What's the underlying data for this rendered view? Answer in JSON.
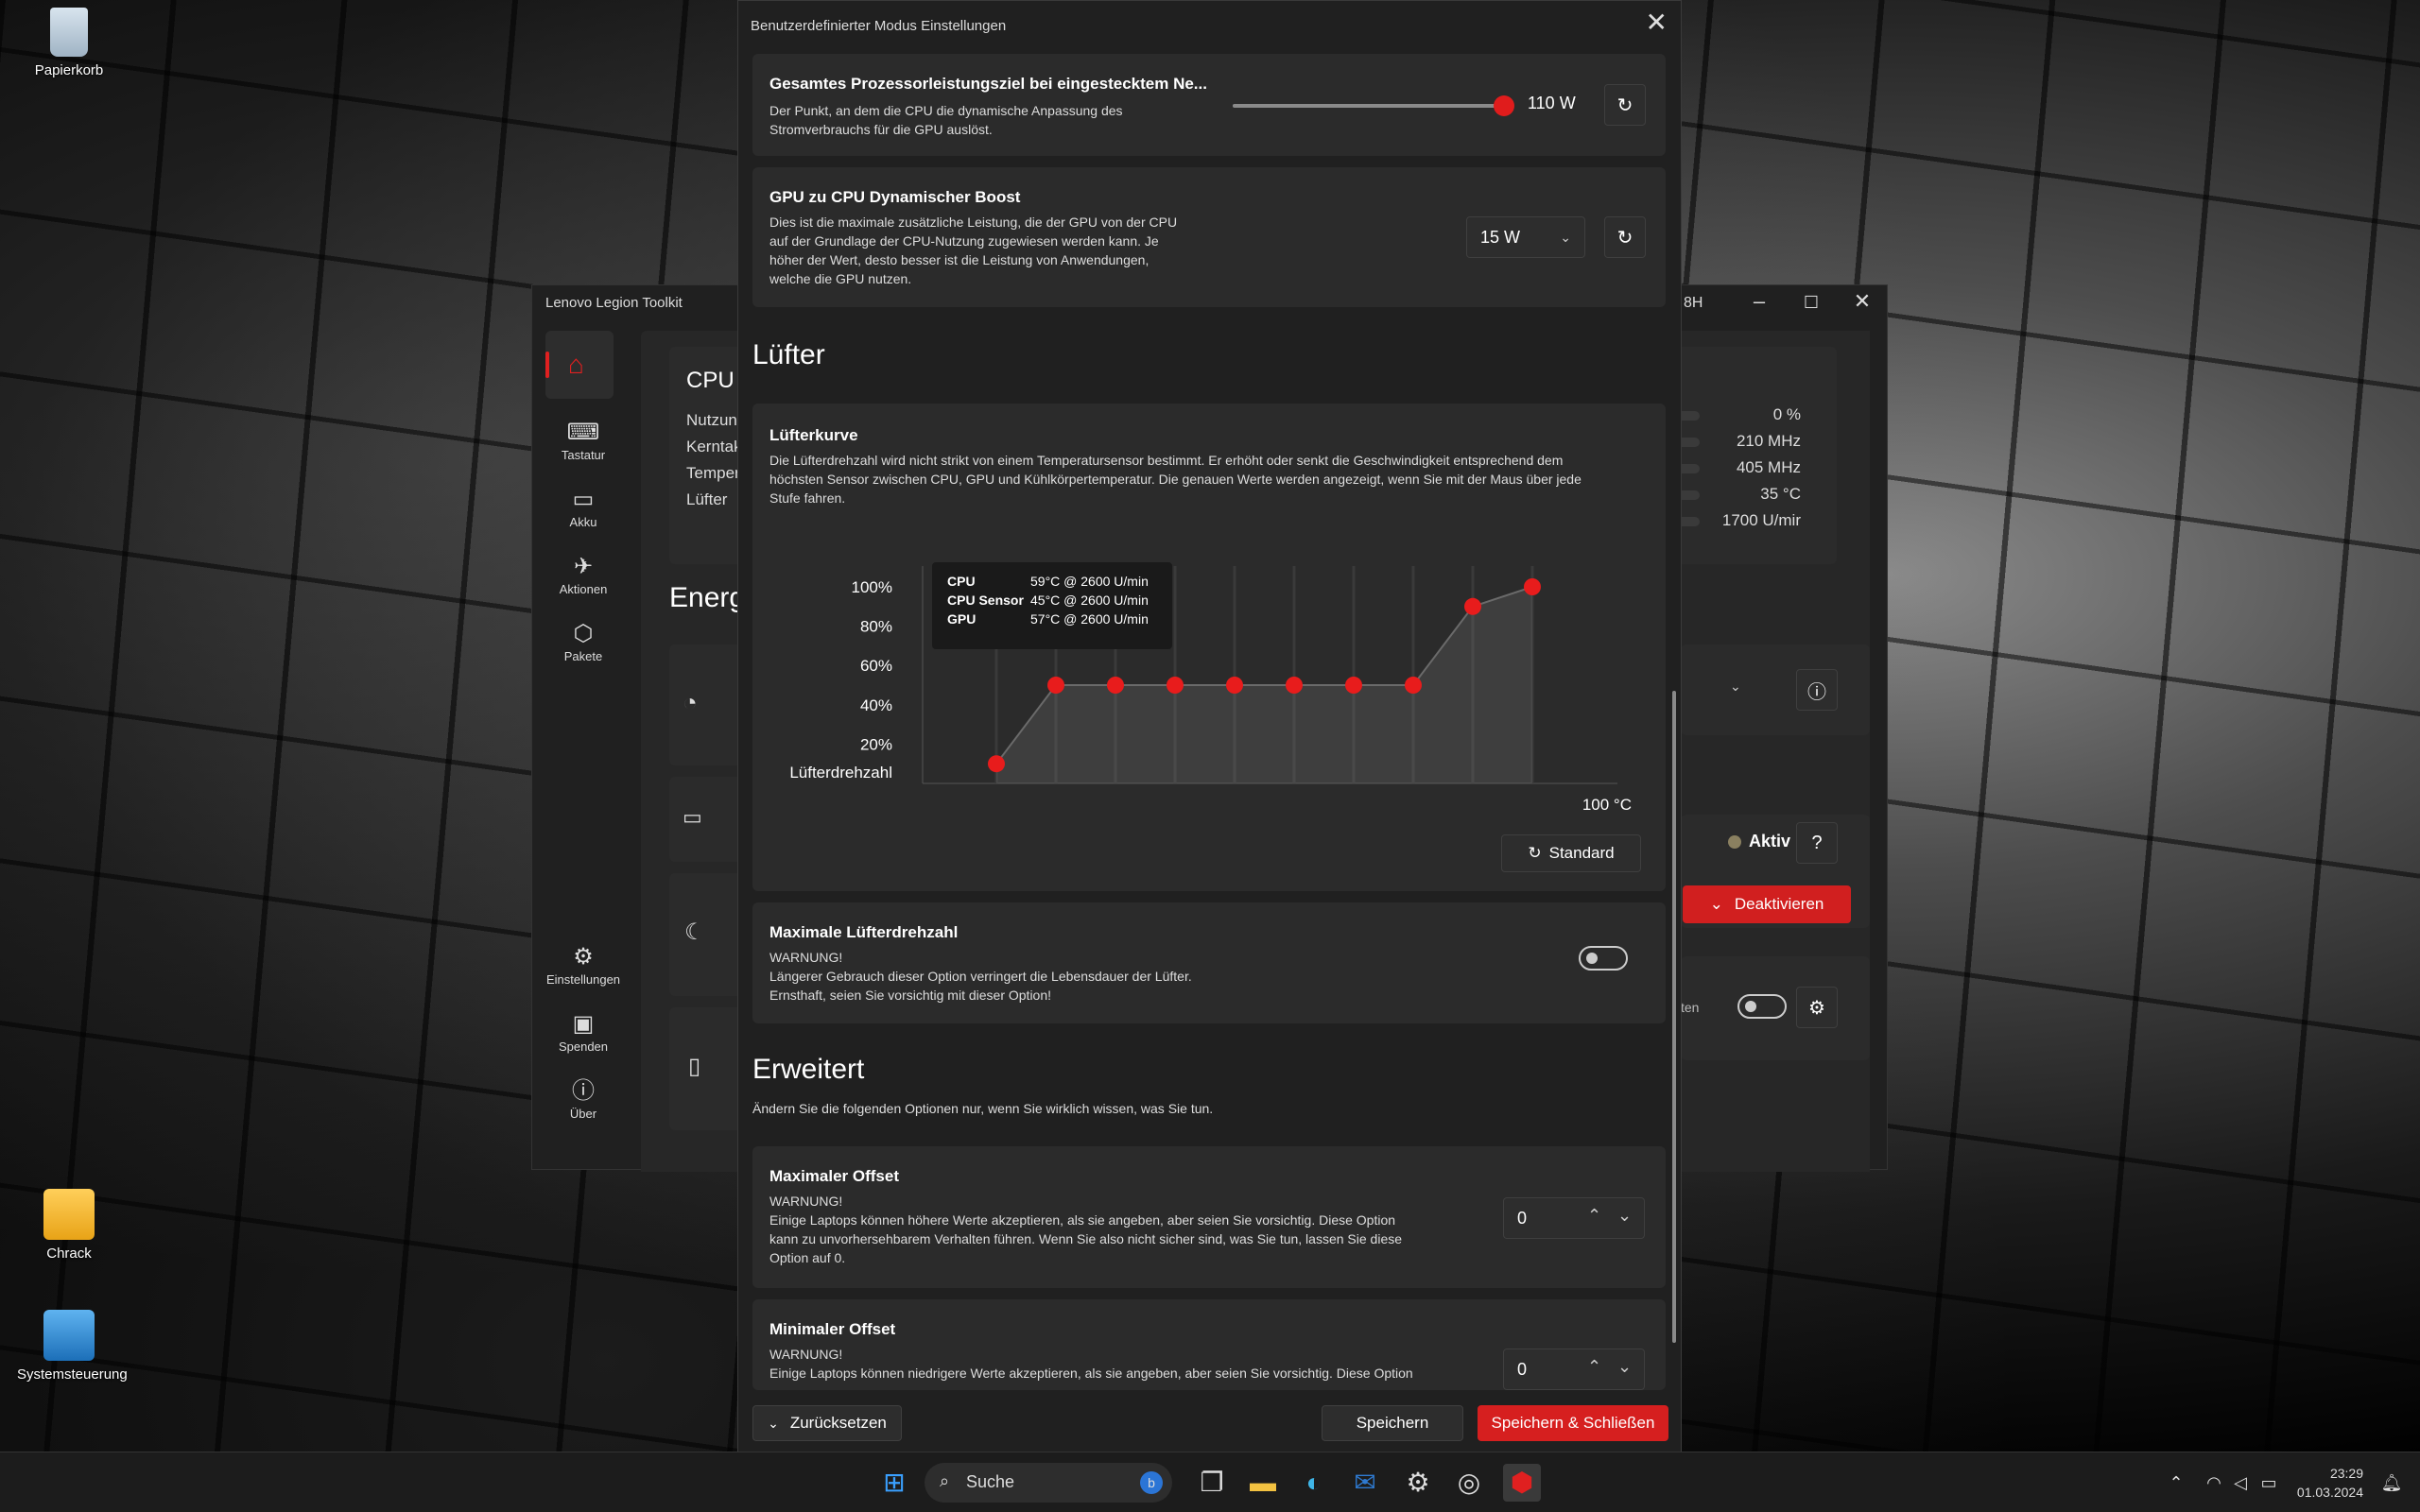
{
  "desktop": {
    "icons": [
      {
        "name": "recycle-bin",
        "label": "Papierkorb"
      },
      {
        "name": "user-folder",
        "label": "Chrack"
      },
      {
        "name": "control-panel",
        "label": "Systemsteuerung"
      }
    ]
  },
  "bgwindow": {
    "title": "Lenovo Legion Toolkit",
    "title_suffix": "8H",
    "nav": [
      {
        "label": "Tastatur",
        "icon": "keyboard-icon"
      },
      {
        "label": "Akku",
        "icon": "battery-icon"
      },
      {
        "label": "Aktionen",
        "icon": "actions-icon"
      },
      {
        "label": "Pakete",
        "icon": "package-icon"
      },
      {
        "label": "Einstellungen",
        "icon": "gear-icon"
      },
      {
        "label": "Spenden",
        "icon": "donate-icon"
      },
      {
        "label": "Über",
        "icon": "info-icon"
      }
    ],
    "cpu_panel": {
      "title": "CPU",
      "rows": [
        "Nutzun",
        "Kerntak",
        "Temper",
        "Lüfter"
      ],
      "values": [
        "0 %",
        "210 MHz",
        "405 MHz",
        "35 °C",
        "1700 U/mir"
      ]
    },
    "energy_heading": "Energ",
    "aktiv_label": "Aktiv",
    "deactivate_label": "Deaktivieren",
    "ten_fragment": "ten"
  },
  "dialog": {
    "title": "Benutzerdefinierter Modus Einstellungen",
    "power_target": {
      "title": "Gesamtes Prozessorleistungsziel bei eingestecktem Ne...",
      "desc1": "Der Punkt, an dem die CPU die dynamische Anpassung des",
      "desc2": "Stromverbrauchs für die GPU auslöst.",
      "value": "110 W",
      "slider_fraction": 0.99
    },
    "gpu_boost": {
      "title": "GPU zu CPU Dynamischer Boost",
      "desc1": "Dies ist die maximale zusätzliche Leistung, die der GPU von der CPU",
      "desc2": "auf der Grundlage der CPU-Nutzung zugewiesen werden kann. Je",
      "desc3": "höher der Wert, desto besser ist die Leistung von Anwendungen,",
      "desc4": "welche die GPU nutzen.",
      "selected": "15 W"
    },
    "fans_heading": "Lüfter",
    "fan_curve": {
      "title": "Lüfterkurve",
      "desc1": "Die Lüfterdrehzahl wird nicht strikt von einem Temperatursensor bestimmt. Er erhöht oder senkt die Geschwindigkeit entsprechend dem",
      "desc2": "höchsten Sensor zwischen CPU, GPU und Kühlkörpertemperatur. Die genauen Werte werden angezeigt, wenn Sie mit der Maus über jede",
      "desc3": "Stufe fahren.",
      "standard_label": "Standard"
    },
    "max_fan": {
      "title": "Maximale Lüfterdrehzahl",
      "line1": "WARNUNG!",
      "line2": "Längerer Gebrauch dieser Option verringert die Lebensdauer der Lüfter.",
      "line3": "Ernsthaft, seien Sie vorsichtig mit dieser Option!"
    },
    "advanced_heading": "Erweitert",
    "advanced_desc": "Ändern Sie die folgenden Optionen nur, wenn Sie wirklich wissen, was Sie tun.",
    "max_offset": {
      "title": "Maximaler Offset",
      "line1": "WARNUNG!",
      "line2": "Einige Laptops können höhere Werte akzeptieren, als sie angeben, aber seien Sie vorsichtig. Diese Option",
      "line3": "kann zu unvorhersehbarem Verhalten führen. Wenn Sie also nicht sicher sind, was Sie tun, lassen Sie diese",
      "line4": "Option auf 0.",
      "value": "0"
    },
    "min_offset": {
      "title": "Minimaler Offset",
      "line1": "WARNUNG!",
      "line2": "Einige Laptops können niedrigere Werte akzeptieren, als sie angeben, aber seien Sie vorsichtig. Diese Option",
      "value": "0"
    },
    "footer": {
      "reset": "Zurücksetzen",
      "save": "Speichern",
      "save_close": "Speichern & Schließen"
    }
  },
  "chart_data": {
    "type": "line",
    "x": [
      1,
      2,
      3,
      4,
      5,
      6,
      7,
      8,
      9,
      10
    ],
    "values": [
      10,
      50,
      50,
      50,
      50,
      50,
      50,
      50,
      90,
      100
    ],
    "ylabel": "Lüfterdrehzahl",
    "xlabel": "100 °C",
    "yticks": [
      "100%",
      "80%",
      "60%",
      "40%",
      "20%"
    ],
    "ylim": [
      0,
      100
    ],
    "tooltip": [
      {
        "sensor": "CPU",
        "value": "59°C @ 2600 U/min"
      },
      {
        "sensor": "CPU Sensor",
        "value": "45°C @ 2600 U/min"
      },
      {
        "sensor": "GPU",
        "value": "57°C @ 2600 U/min"
      }
    ]
  },
  "taskbar": {
    "search": "Suche",
    "time": "23:29",
    "date": "01.03.2024"
  }
}
